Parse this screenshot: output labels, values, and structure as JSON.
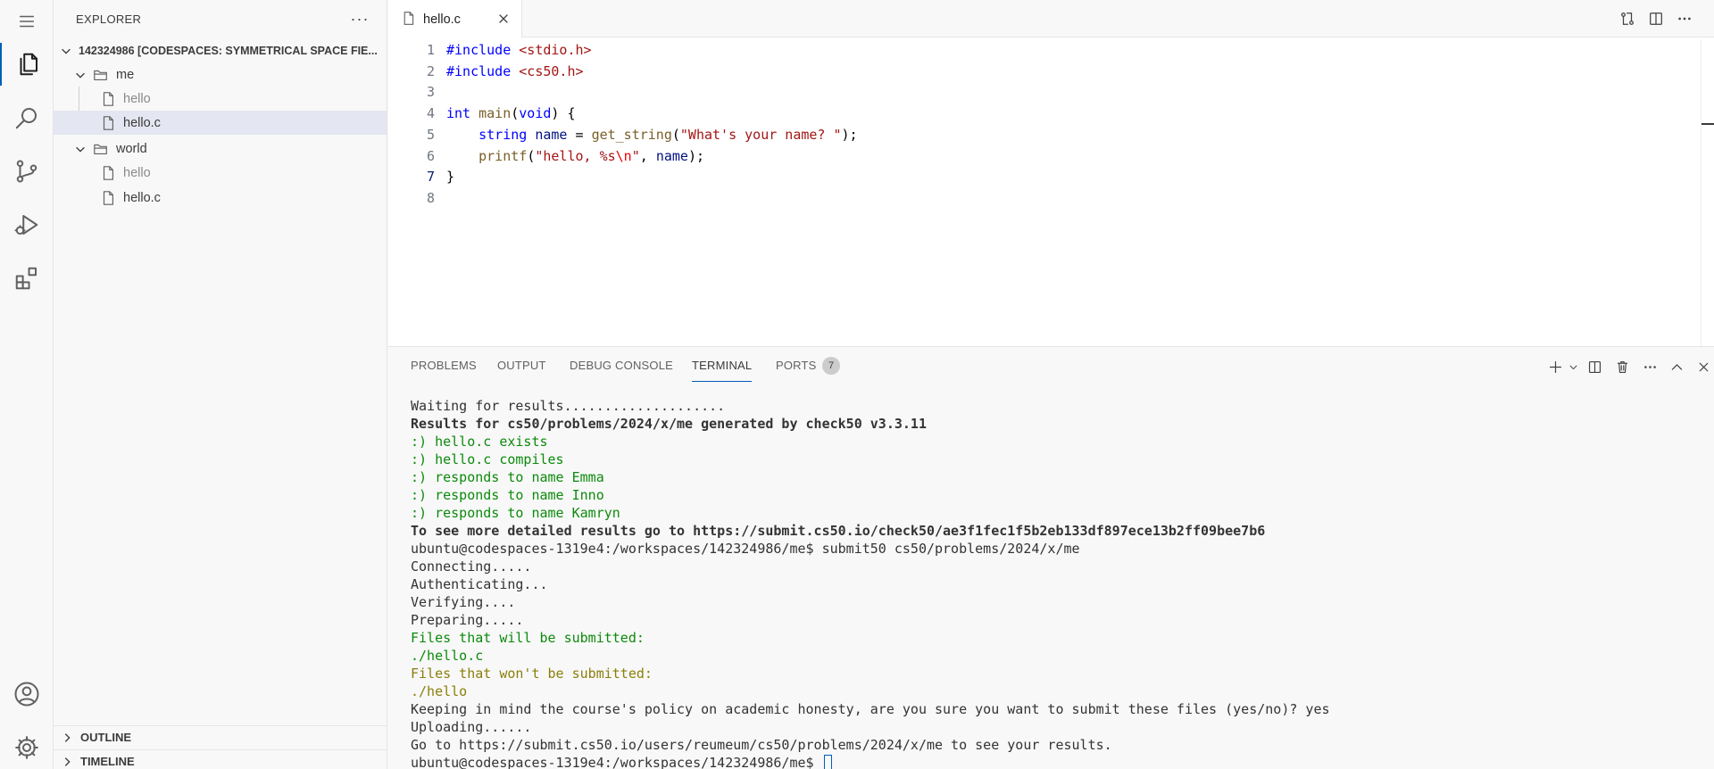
{
  "sidebar": {
    "title": "EXPLORER",
    "more_label": "···",
    "root_label": "142324986 [CODESPACES: SYMMETRICAL SPACE FIE...",
    "tree": [
      {
        "label": "me",
        "kind": "folder"
      },
      {
        "label": "hello",
        "kind": "file"
      },
      {
        "label": "hello.c",
        "kind": "file"
      },
      {
        "label": "world",
        "kind": "folder"
      },
      {
        "label": "hello",
        "kind": "file"
      },
      {
        "label": "hello.c",
        "kind": "file"
      }
    ],
    "outline_label": "OUTLINE",
    "timeline_label": "TIMELINE"
  },
  "editor": {
    "tab_label": "hello.c",
    "line_numbers": [
      "1",
      "2",
      "3",
      "4",
      "5",
      "6",
      "7",
      "8"
    ],
    "current_line": 7,
    "code": [
      [
        {
          "t": "#include",
          "c": "pp"
        },
        {
          "t": " <stdio.h>",
          "c": "hdr"
        }
      ],
      [
        {
          "t": "#include",
          "c": "pp"
        },
        {
          "t": " <cs50.h>",
          "c": "hdr"
        }
      ],
      [],
      [
        {
          "t": "int",
          "c": "ty"
        },
        {
          "t": " "
        },
        {
          "t": "main",
          "c": "fn"
        },
        {
          "t": "("
        },
        {
          "t": "void",
          "c": "ty"
        },
        {
          "t": ") {"
        }
      ],
      [
        {
          "t": "    "
        },
        {
          "t": "string",
          "c": "ty"
        },
        {
          "t": " "
        },
        {
          "t": "name",
          "c": "var"
        },
        {
          "t": " = "
        },
        {
          "t": "get_string",
          "c": "fn"
        },
        {
          "t": "("
        },
        {
          "t": "\"What's your name? \"",
          "c": "str"
        },
        {
          "t": ");"
        }
      ],
      [
        {
          "t": "    "
        },
        {
          "t": "printf",
          "c": "fn"
        },
        {
          "t": "("
        },
        {
          "t": "\"hello, %s",
          "c": "str"
        },
        {
          "t": "\\n",
          "c": "esc"
        },
        {
          "t": "\"",
          "c": "str"
        },
        {
          "t": ", "
        },
        {
          "t": "name",
          "c": "var"
        },
        {
          "t": ");"
        }
      ],
      [
        {
          "t": "}"
        }
      ],
      []
    ]
  },
  "panel": {
    "tabs": [
      "PROBLEMS",
      "OUTPUT",
      "DEBUG CONSOLE",
      "TERMINAL",
      "PORTS"
    ],
    "active_tab": "TERMINAL",
    "ports_count": "7",
    "terminal_lines": [
      {
        "text": "Waiting for results....................",
        "style": "normal"
      },
      {
        "text": "Results for cs50/problems/2024/x/me generated by check50 v3.3.11",
        "style": "bold"
      },
      {
        "text": ":) hello.c exists",
        "style": "green"
      },
      {
        "text": ":) hello.c compiles",
        "style": "green"
      },
      {
        "text": ":) responds to name Emma",
        "style": "green"
      },
      {
        "text": ":) responds to name Inno",
        "style": "green"
      },
      {
        "text": ":) responds to name Kamryn",
        "style": "green"
      },
      {
        "text": "To see more detailed results go to https://submit.cs50.io/check50/ae3f1fec1f5b2eb133df897ece13b2ff09bee7b6",
        "style": "bold"
      },
      {
        "text": "ubuntu@codespaces-1319e4:/workspaces/142324986/me$ submit50 cs50/problems/2024/x/me",
        "style": "normal"
      },
      {
        "text": "Connecting.....",
        "style": "normal"
      },
      {
        "text": "Authenticating...",
        "style": "normal"
      },
      {
        "text": "Verifying....",
        "style": "normal"
      },
      {
        "text": "Preparing.....",
        "style": "normal"
      },
      {
        "text": "Files that will be submitted:",
        "style": "green"
      },
      {
        "text": "./hello.c",
        "style": "green"
      },
      {
        "text": "Files that won't be submitted:",
        "style": "olive"
      },
      {
        "text": "./hello",
        "style": "olive"
      },
      {
        "text": "Keeping in mind the course's policy on academic honesty, are you sure you want to submit these files (yes/no)? yes",
        "style": "normal"
      },
      {
        "text": "Uploading......",
        "style": "normal"
      },
      {
        "text": "Go to https://submit.cs50.io/users/reumeum/cs50/problems/2024/x/me to see your results.",
        "style": "normal"
      }
    ],
    "prompt": "ubuntu@codespaces-1319e4:/workspaces/142324986/me$ "
  },
  "colors": {
    "accent": "#005fb8",
    "selection": "#e4e6f1",
    "terminal_green": "#0c8a0c",
    "terminal_olive": "#8a7f0b"
  },
  "icons": [
    "menu-icon",
    "files-icon",
    "search-icon",
    "source-control-icon",
    "run-debug-icon",
    "extensions-icon",
    "account-icon",
    "settings-gear-icon",
    "folder-icon",
    "file-icon",
    "chevron-down-icon",
    "chevron-right-icon",
    "close-icon",
    "compare-icon",
    "split-editor-icon",
    "more-icon",
    "plus-icon",
    "trash-icon",
    "chevron-up-icon"
  ]
}
